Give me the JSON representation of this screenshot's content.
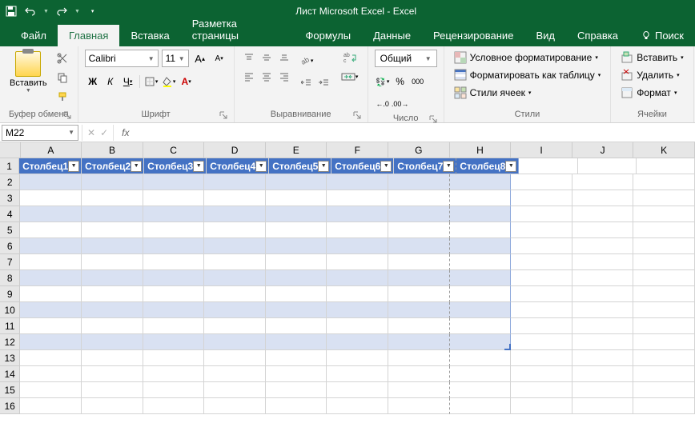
{
  "title": "Лист Microsoft Excel  -  Excel",
  "tabs": {
    "file": "Файл",
    "home": "Главная",
    "insert": "Вставка",
    "layout": "Разметка страницы",
    "formulas": "Формулы",
    "data": "Данные",
    "review": "Рецензирование",
    "view": "Вид",
    "help": "Справка",
    "search": "Поиск"
  },
  "ribbon": {
    "clipboard": {
      "paste": "Вставить",
      "label": "Буфер обмена"
    },
    "font": {
      "name": "Calibri",
      "size": "11",
      "label": "Шрифт",
      "bold": "Ж",
      "italic": "К",
      "underline": "Ч"
    },
    "alignment": {
      "label": "Выравнивание"
    },
    "number": {
      "format": "Общий",
      "label": "Число"
    },
    "styles": {
      "conditional": "Условное форматирование",
      "table": "Форматировать как таблицу",
      "cell": "Стили ячеек",
      "label": "Стили"
    },
    "cells": {
      "insert": "Вставить",
      "delete": "Удалить",
      "format": "Формат",
      "label": "Ячейки"
    }
  },
  "formula": {
    "namebox": "M22",
    "fx": "fx"
  },
  "grid": {
    "cols": [
      "A",
      "B",
      "C",
      "D",
      "E",
      "F",
      "G",
      "H",
      "I",
      "J",
      "K"
    ],
    "rows": [
      "1",
      "2",
      "3",
      "4",
      "5",
      "6",
      "7",
      "8",
      "9",
      "10",
      "11",
      "12",
      "13",
      "14",
      "15",
      "16"
    ],
    "table_headers": [
      "Столбец1",
      "Столбец2",
      "Столбец3",
      "Столбец4",
      "Столбец5",
      "Столбец6",
      "Столбец7",
      "Столбец8"
    ],
    "table_cols": 8,
    "table_rows": 12,
    "page_break_col": 7
  }
}
